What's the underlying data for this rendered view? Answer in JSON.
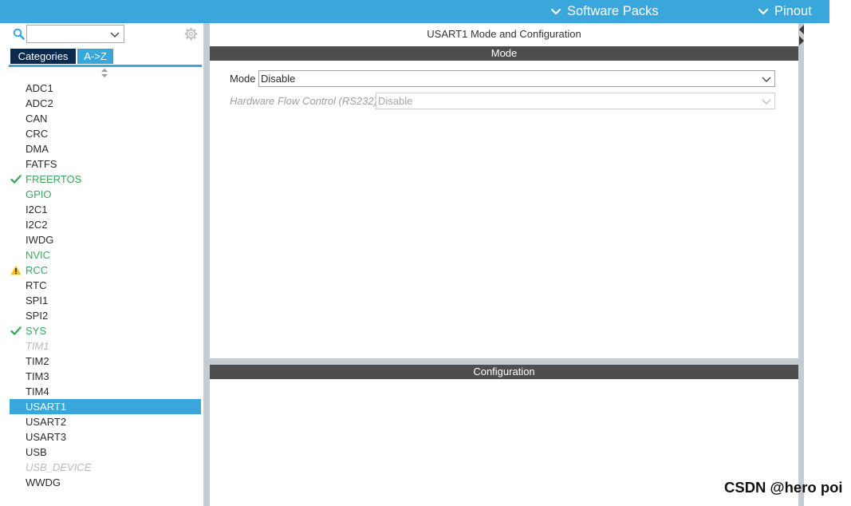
{
  "topbar": {
    "items": [
      {
        "label": "Software Packs",
        "icon": "chevron-down-icon"
      },
      {
        "label": "Pinout",
        "icon": "chevron-down-icon"
      }
    ]
  },
  "sidebar": {
    "search": {
      "value": "",
      "icon": "search-icon"
    },
    "settings_icon": "gear-icon",
    "tabs": [
      {
        "label": "Categories",
        "active": false
      },
      {
        "label": "A->Z",
        "active": true
      }
    ],
    "sort_icon": "sort-icon",
    "items": [
      {
        "label": "ADC1"
      },
      {
        "label": "ADC2"
      },
      {
        "label": "CAN"
      },
      {
        "label": "CRC"
      },
      {
        "label": "DMA"
      },
      {
        "label": "FATFS"
      },
      {
        "label": "FREERTOS",
        "configured": true,
        "icon": "check-icon"
      },
      {
        "label": "GPIO",
        "configured": true
      },
      {
        "label": "I2C1"
      },
      {
        "label": "I2C2"
      },
      {
        "label": "IWDG"
      },
      {
        "label": "NVIC",
        "configured": true
      },
      {
        "label": "RCC",
        "configured": true,
        "icon": "warning-icon"
      },
      {
        "label": "RTC"
      },
      {
        "label": "SPI1"
      },
      {
        "label": "SPI2"
      },
      {
        "label": "SYS",
        "configured": true,
        "icon": "check-icon"
      },
      {
        "label": "TIM1",
        "disabled": true
      },
      {
        "label": "TIM2"
      },
      {
        "label": "TIM3"
      },
      {
        "label": "TIM4"
      },
      {
        "label": "USART1",
        "selected": true
      },
      {
        "label": "USART2"
      },
      {
        "label": "USART3"
      },
      {
        "label": "USB"
      },
      {
        "label": "USB_DEVICE",
        "disabled": true
      },
      {
        "label": "WWDG"
      }
    ]
  },
  "main": {
    "title": "USART1 Mode and Configuration",
    "mode_section": {
      "header": "Mode",
      "fields": [
        {
          "label": "Mode",
          "value": "Disable",
          "disabled": false,
          "icon": "chevron-down-icon"
        },
        {
          "label": "Hardware Flow Control (RS232)",
          "value": "Disable",
          "disabled": true,
          "icon": "chevron-down-icon"
        }
      ]
    },
    "configuration_section": {
      "header": "Configuration"
    },
    "side_toggles": [
      "collapse-left-icon",
      "expand-right-icon"
    ]
  },
  "watermark": "CSDN @hero poi",
  "colors": {
    "accent": "#39a7db",
    "tab_dark": "#0a2a4f",
    "configured": "#3aa65e",
    "disabled_text": "#b5bcc0",
    "section_header": "#4e4e4e",
    "warning": "#f4c20d",
    "frame": "#c4ccd1"
  }
}
